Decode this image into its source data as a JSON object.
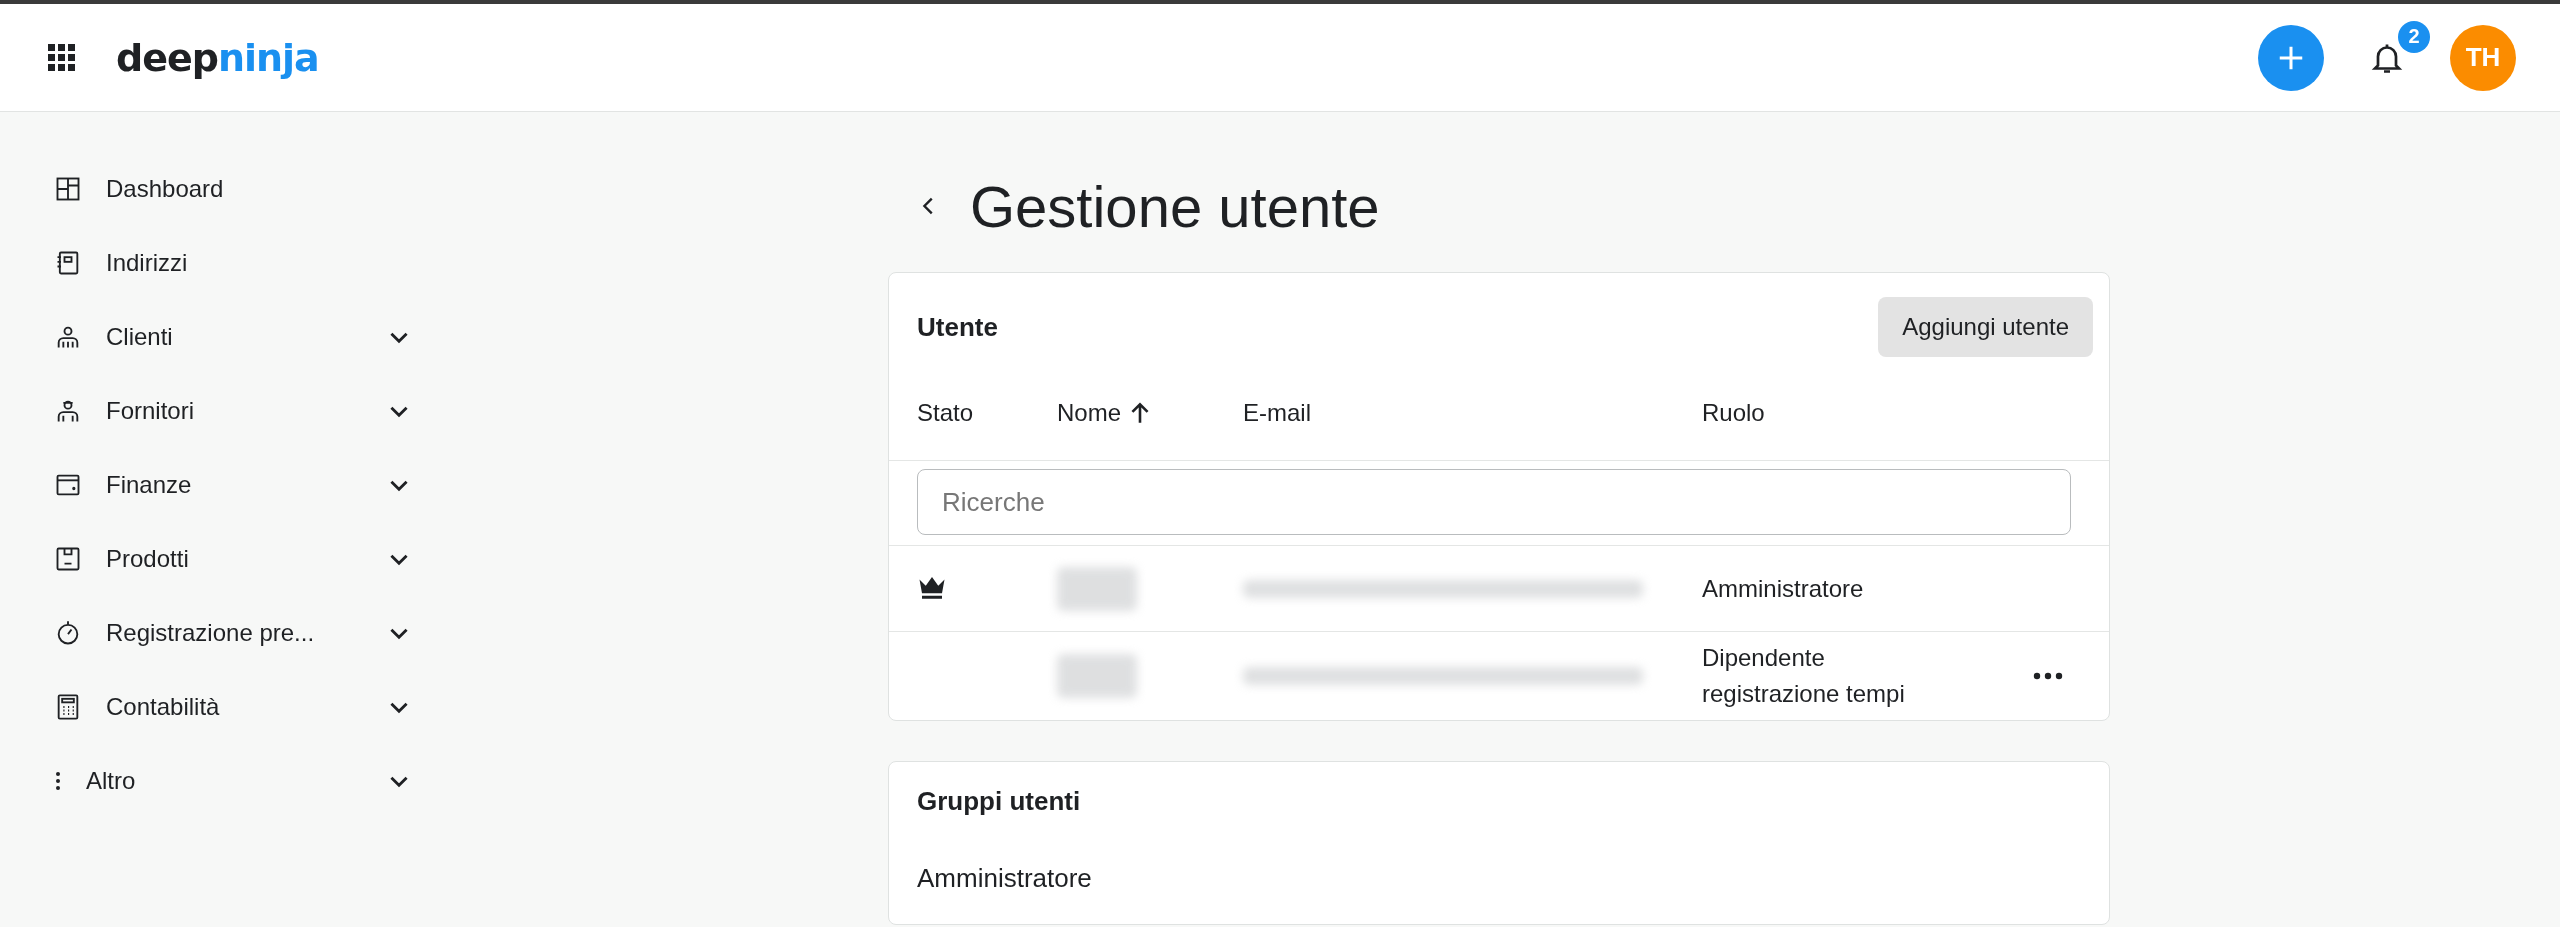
{
  "header": {
    "logo": {
      "primary": "deep",
      "accent": "ninja"
    },
    "notifications": "2",
    "avatar": "TH"
  },
  "sidebar": {
    "items": [
      {
        "label": "Dashboard",
        "kind": "dashboard",
        "expandable": false
      },
      {
        "label": "Indirizzi",
        "kind": "addressbook",
        "expandable": false
      },
      {
        "label": "Clienti",
        "kind": "customers",
        "expandable": true
      },
      {
        "label": "Fornitori",
        "kind": "suppliers",
        "expandable": true
      },
      {
        "label": "Finanze",
        "kind": "wallet",
        "expandable": true
      },
      {
        "label": "Prodotti",
        "kind": "box",
        "expandable": true
      },
      {
        "label": "Registrazione pre...",
        "kind": "timer",
        "expandable": true
      },
      {
        "label": "Contabilità",
        "kind": "calculator",
        "expandable": true
      },
      {
        "label": "Altro",
        "kind": "dots",
        "expandable": true
      }
    ]
  },
  "page": {
    "title": "Gestione utente"
  },
  "users_card": {
    "title": "Utente",
    "add_button": "Aggiungi utente",
    "columns": [
      {
        "label": "Stato",
        "sorted": false
      },
      {
        "label": "Nome",
        "sorted": true
      },
      {
        "label": "E-mail",
        "sorted": false
      },
      {
        "label": "Ruolo",
        "sorted": false
      }
    ],
    "search": {
      "placeholder": "Ricerche"
    },
    "rows": [
      {
        "owner": true,
        "role": "Amministratore",
        "menu": false
      },
      {
        "owner": false,
        "role": "Dipendente registrazione tempi",
        "menu": true
      }
    ]
  },
  "groups_card": {
    "title": "Gruppi utenti",
    "groups": [
      "Amministratore"
    ]
  }
}
